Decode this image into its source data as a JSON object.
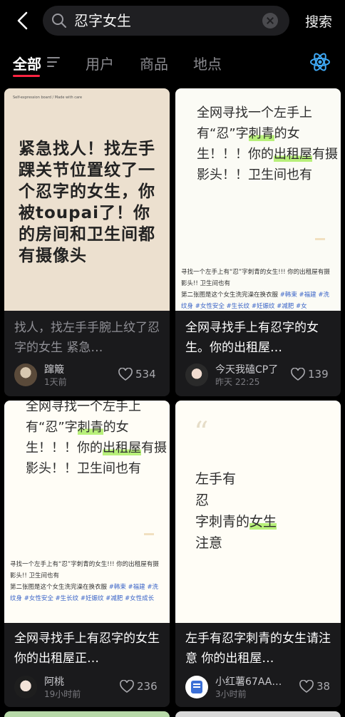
{
  "header": {
    "query": "忍字女生",
    "search_label": "搜索"
  },
  "tabs": [
    {
      "label": "全部"
    },
    {
      "label": "用户"
    },
    {
      "label": "商品"
    },
    {
      "label": "地点"
    }
  ],
  "colors": {
    "accent": "#ff2442",
    "link": "#3a64c8",
    "highlight": "#b8f07a"
  },
  "cards": [
    {
      "cover_text": "紧急找人！找左手踝关节位置纹了一个忍字的女生，你被toupai了！你的房间和卫生间都有摄像头",
      "cover_mark": "Self-expression board / Made with care",
      "caption": "找人，找左手手腕上纹了忍字的女生 紧急…",
      "author": "蹿簸",
      "time": "1天前",
      "likes": "534"
    },
    {
      "cover_title_a": "全网寻找一个左手上有“忍”字",
      "cover_title_hl1": "刺青",
      "cover_title_b": "的女生！！！你的",
      "cover_title_hl2": "出租屋",
      "cover_title_c": "有摄影头！！卫生间也有",
      "body_a": "寻找一个左手上有“忍”字刺青的女生!!! 你的出租屋有摄影头!! 卫生间也有",
      "body_b": "第二张图是这个女生洗完澡在换衣服",
      "tags": "#韩束 #福建 #洗纹身 #女性安全 #生长纹 #妊娠纹 #减肥 #女",
      "caption": "全网寻找手上有忍字的女生。你的出租屋…",
      "author": "今天我磕CP了",
      "time": "昨天 22:25",
      "likes": "139"
    },
    {
      "cover_title_a": "全网寻找一个左手上有“忍”字",
      "cover_title_hl1": "刺青",
      "cover_title_b": "的女生！！！你的",
      "cover_title_hl2": "出租屋",
      "cover_title_c": "有摄影头！！卫生间也有",
      "body_a": "寻找一个左手上有“忍”字刺青的女生!!! 你的出租屋有摄影头!! 卫生间也有",
      "body_b": "第二张图是这个女生洗完澡在换衣服",
      "tags": "#韩束 #福建 #洗纹身 #女性安全 #生长纹 #妊娠纹 #减肥 #女性成长",
      "caption": "全网寻找手上有忍字的女生 你的出租屋正…",
      "author": "阿桃",
      "time": "19小时前",
      "likes": "236"
    },
    {
      "cover_quote": "“",
      "cover_line1": "左手有",
      "cover_line2": "忍",
      "cover_line3a": "字刺青的",
      "cover_line3hl": "女生",
      "cover_line4": "注意",
      "caption": "左手有忍字刺青的女生请注意 你的出租屋…",
      "author": "小红薯67AA…",
      "time": "3小时前",
      "likes": "38"
    }
  ]
}
